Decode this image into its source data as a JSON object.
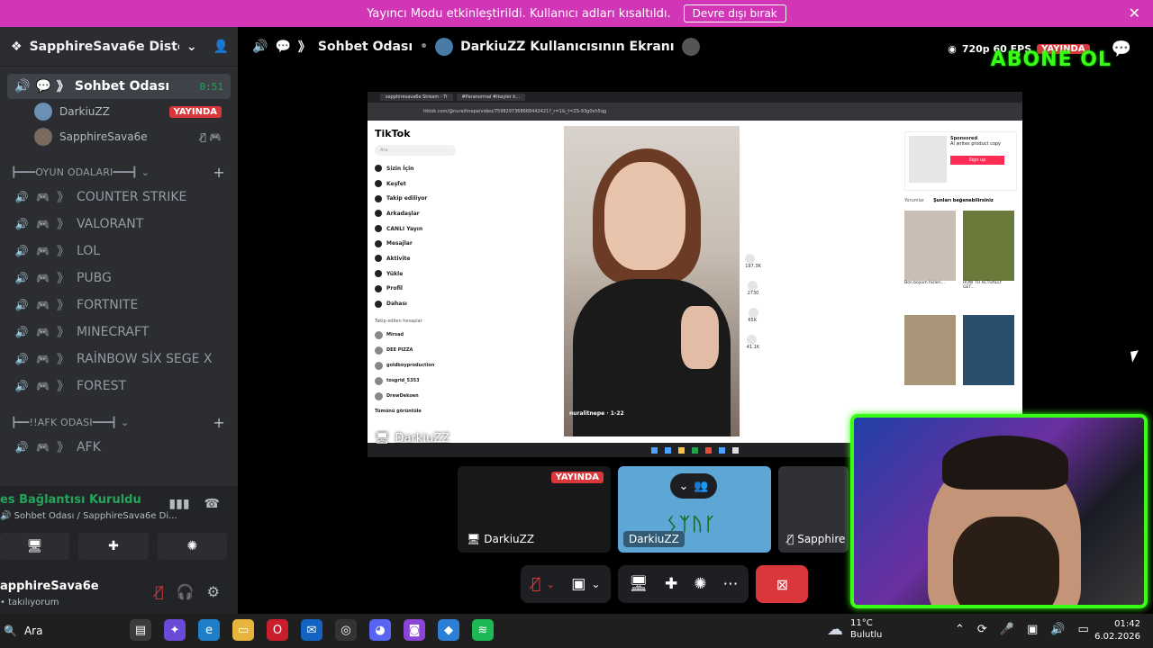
{
  "banner": {
    "message": "Yayıncı Modu etkinleştirildi. Kullanıcı adları kısaltıldı.",
    "button": "Devre dışı bırak",
    "close_icon": "close-icon"
  },
  "sidebar": {
    "server_name": "SapphireSava6e Distopik...",
    "active_voice": {
      "name": "Sohbet Odası",
      "timer": "0:51"
    },
    "members": [
      {
        "name": "DarkiuZZ",
        "badge": "YAYINDA"
      },
      {
        "name": "SapphireSava6e"
      }
    ],
    "categories": [
      {
        "label": "┣━━━OYUN ODALARI━━━┫",
        "channels": [
          "COUNTER STRIKE",
          "VALORANT",
          "LOL",
          "PUBG",
          "FORTNITE",
          "MINECRAFT",
          "RAİNBOW SİX SEGE X",
          "FOREST"
        ]
      },
      {
        "label": "┣━━!!AFK ODASI━━━┫",
        "channels": [
          "AFK"
        ]
      }
    ],
    "channel_prefix": "》"
  },
  "voice_panel": {
    "status": "es Bağlantısı Kuruldu",
    "subtitle": "Sohbet Odası / SapphireSava6e Di..."
  },
  "user_panel": {
    "name": "apphireSava6e",
    "status": "takılıyorum"
  },
  "main": {
    "channel": "Sohbet Odası",
    "stream_title": "DarkiuZZ Kullanıcısının Ekranı",
    "quality": "720p 60 FPS",
    "live": "YAYINDA",
    "overlay_text": "ABONE OL",
    "browser_label": "DarkiuZZ",
    "tiles": [
      {
        "label": "DarkiuZZ",
        "badge": "YAYINDA"
      },
      {
        "label": "DarkiuZZ",
        "runes": "ᛊᛉᚢᚴ"
      },
      {
        "label": "Sapphire"
      }
    ]
  },
  "tiktok": {
    "logo": "TikTok",
    "search": "Ara",
    "url": "tiktok.com/@nuralitnepe/video/7598297368668442421?_r=1&_t=ZS-93g0xh5qg",
    "tabs": [
      "sapphiresava6e Stream - Tr",
      "#Paranormal #ikayler k..."
    ],
    "nav": [
      "Sizin İçin",
      "Keşfet",
      "Takip ediliyor",
      "Arkadaşlar",
      "CANLI Yayın",
      "Mesajlar",
      "Aktivite",
      "Yükle",
      "Profil",
      "Dahası"
    ],
    "following_header": "Takip edilen hesaplar",
    "following": [
      "Mirsad",
      "DEE PIZZA",
      "goldboyproduction",
      "tosgrid_5353",
      "DrewDekoen"
    ],
    "show_all": "Tümünü görüntüle",
    "video_caption": "nuralitnepe · 1-22",
    "actions": [
      "197.3K",
      "2730",
      "65K",
      "41.1K"
    ],
    "ad_sponsored": "Sponsored",
    "ad_title": "AI writes product copy",
    "ad_button": "Sign up",
    "right_tabs": [
      "Yorumlar",
      "Şunları beğenebilirsiniz"
    ],
    "thumbs": [
      "Bon boyum hisleri...",
      "HOW TO ACTUALLY GET...",
      "",
      ""
    ]
  },
  "taskbar": {
    "search": "Ara",
    "weather_temp": "11°C",
    "weather_desc": "Bulutlu",
    "time": "01:42",
    "date": "6.02.2026"
  }
}
